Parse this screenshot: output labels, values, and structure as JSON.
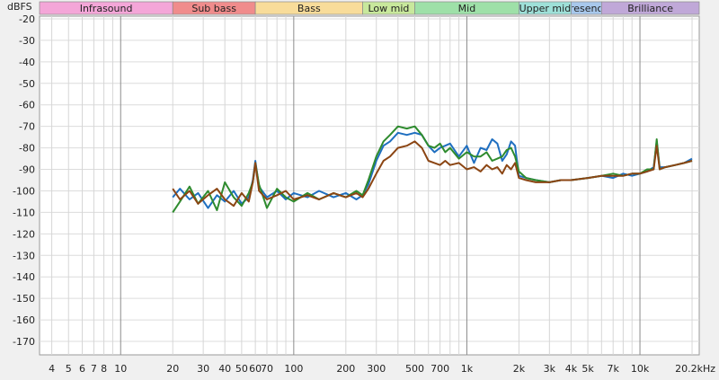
{
  "chart_data": {
    "type": "line",
    "ylabel": "dBFS",
    "x_scale": "log",
    "xlim": [
      3.4,
      22000
    ],
    "ylim": [
      -180,
      -20
    ],
    "grid": true,
    "y_ticks": [
      -20,
      -30,
      -40,
      -50,
      -60,
      -70,
      -80,
      -90,
      -100,
      -110,
      -120,
      -130,
      -140,
      -150,
      -160,
      -170
    ],
    "x_ticks": [
      {
        "v": 4,
        "label": "4"
      },
      {
        "v": 5,
        "label": "5"
      },
      {
        "v": 6,
        "label": "6"
      },
      {
        "v": 7,
        "label": "7"
      },
      {
        "v": 8,
        "label": "8"
      },
      {
        "v": 10,
        "label": "10"
      },
      {
        "v": 20,
        "label": "20"
      },
      {
        "v": 30,
        "label": "30"
      },
      {
        "v": 40,
        "label": "40"
      },
      {
        "v": 50,
        "label": "50"
      },
      {
        "v": 60,
        "label": "60"
      },
      {
        "v": 70,
        "label": "70"
      },
      {
        "v": 100,
        "label": "100"
      },
      {
        "v": 200,
        "label": "200"
      },
      {
        "v": 300,
        "label": "300"
      },
      {
        "v": 500,
        "label": "500"
      },
      {
        "v": 700,
        "label": "700"
      },
      {
        "v": 1000,
        "label": "1k"
      },
      {
        "v": 2000,
        "label": "2k"
      },
      {
        "v": 3000,
        "label": "3k"
      },
      {
        "v": 4000,
        "label": "4k"
      },
      {
        "v": 5000,
        "label": "5k"
      },
      {
        "v": 7000,
        "label": "7k"
      },
      {
        "v": 10000,
        "label": "10k"
      },
      {
        "v": 20200,
        "label": "20.2kHz"
      }
    ],
    "bands": [
      {
        "name": "Infrasound",
        "from": 3.4,
        "to": 20,
        "color": "#f4a6d8"
      },
      {
        "name": "Sub bass",
        "from": 20,
        "to": 60,
        "color": "#f08c8c"
      },
      {
        "name": "Bass",
        "from": 60,
        "to": 250,
        "color": "#f8dc9a"
      },
      {
        "name": "Low mid",
        "from": 250,
        "to": 500,
        "color": "#c8e89c"
      },
      {
        "name": "Mid",
        "from": 500,
        "to": 2000,
        "color": "#9ee0a8"
      },
      {
        "name": "Upper mid",
        "from": 2000,
        "to": 4000,
        "color": "#9ee0d8"
      },
      {
        "name": "Presence",
        "from": 4000,
        "to": 6000,
        "color": "#a8c8ec"
      },
      {
        "name": "Brilliance",
        "from": 6000,
        "to": 22000,
        "color": "#c0a8d8"
      }
    ],
    "series": [
      {
        "color": "#1f6fc0",
        "x": [
          20,
          22,
          25,
          28,
          32,
          36,
          40,
          45,
          50,
          55,
          58,
          60,
          63,
          70,
          80,
          90,
          100,
          120,
          140,
          170,
          200,
          230,
          250,
          270,
          300,
          330,
          360,
          400,
          450,
          500,
          550,
          600,
          650,
          700,
          750,
          800,
          900,
          1000,
          1100,
          1200,
          1300,
          1400,
          1500,
          1600,
          1700,
          1800,
          1900,
          2000,
          2200,
          2500,
          3000,
          3500,
          4000,
          5000,
          6000,
          7000,
          8000,
          9000,
          10000,
          11000,
          12000,
          12500,
          13000,
          14000,
          16000,
          18000,
          20000
        ],
        "y": [
          -103,
          -99,
          -104,
          -101,
          -108,
          -102,
          -105,
          -100,
          -106,
          -103,
          -95,
          -86,
          -98,
          -103,
          -100,
          -104,
          -101,
          -103,
          -100,
          -103,
          -101,
          -104,
          -102,
          -97,
          -86,
          -79,
          -77,
          -73,
          -74,
          -73,
          -74,
          -79,
          -82,
          -80,
          -79,
          -78,
          -84,
          -79,
          -87,
          -80,
          -81,
          -76,
          -78,
          -86,
          -83,
          -77,
          -79,
          -93,
          -94,
          -95,
          -96,
          -95,
          -95,
          -94,
          -93,
          -94,
          -92,
          -93,
          -92,
          -91,
          -89,
          -77,
          -89,
          -89,
          -88,
          -87,
          -85
        ]
      },
      {
        "color": "#2e8b2e",
        "x": [
          20,
          22,
          25,
          28,
          32,
          36,
          40,
          45,
          50,
          55,
          58,
          60,
          63,
          70,
          80,
          90,
          100,
          120,
          140,
          170,
          200,
          230,
          250,
          270,
          300,
          330,
          360,
          400,
          450,
          500,
          550,
          600,
          650,
          700,
          750,
          800,
          900,
          1000,
          1100,
          1200,
          1300,
          1400,
          1500,
          1600,
          1700,
          1800,
          1900,
          2000,
          2200,
          2500,
          3000,
          3500,
          4000,
          5000,
          6000,
          7000,
          8000,
          9000,
          10000,
          11000,
          12000,
          12500,
          13000,
          14000,
          16000,
          18000,
          20000
        ],
        "y": [
          -110,
          -105,
          -98,
          -106,
          -100,
          -109,
          -96,
          -103,
          -107,
          -101,
          -96,
          -87,
          -97,
          -108,
          -99,
          -103,
          -105,
          -101,
          -104,
          -101,
          -103,
          -100,
          -102,
          -95,
          -84,
          -77,
          -74,
          -70,
          -71,
          -70,
          -74,
          -79,
          -80,
          -78,
          -82,
          -80,
          -85,
          -82,
          -84,
          -84,
          -82,
          -86,
          -85,
          -84,
          -81,
          -80,
          -84,
          -91,
          -94,
          -95,
          -96,
          -95,
          -95,
          -94,
          -93,
          -92,
          -93,
          -92,
          -92,
          -90,
          -90,
          -76,
          -90,
          -89,
          -88,
          -87,
          -86
        ]
      },
      {
        "color": "#8b4513",
        "x": [
          20,
          22,
          25,
          28,
          32,
          36,
          40,
          45,
          50,
          55,
          58,
          60,
          63,
          70,
          80,
          90,
          100,
          120,
          140,
          170,
          200,
          230,
          250,
          270,
          300,
          330,
          360,
          400,
          450,
          500,
          550,
          600,
          650,
          700,
          750,
          800,
          900,
          1000,
          1100,
          1200,
          1300,
          1400,
          1500,
          1600,
          1700,
          1800,
          1900,
          2000,
          2200,
          2500,
          3000,
          3500,
          4000,
          5000,
          6000,
          7000,
          8000,
          9000,
          10000,
          11000,
          12000,
          12500,
          13000,
          14000,
          16000,
          18000,
          20000
        ],
        "y": [
          -99,
          -104,
          -100,
          -106,
          -102,
          -99,
          -104,
          -107,
          -101,
          -105,
          -96,
          -87,
          -100,
          -104,
          -102,
          -100,
          -104,
          -102,
          -104,
          -101,
          -103,
          -101,
          -103,
          -99,
          -92,
          -86,
          -84,
          -80,
          -79,
          -77,
          -80,
          -86,
          -87,
          -88,
          -86,
          -88,
          -87,
          -90,
          -89,
          -91,
          -88,
          -90,
          -89,
          -92,
          -88,
          -90,
          -87,
          -94,
          -95,
          -96,
          -96,
          -95,
          -95,
          -94,
          -93,
          -93,
          -93,
          -92,
          -92,
          -91,
          -90,
          -79,
          -90,
          -89,
          -88,
          -87,
          -86
        ]
      }
    ]
  }
}
